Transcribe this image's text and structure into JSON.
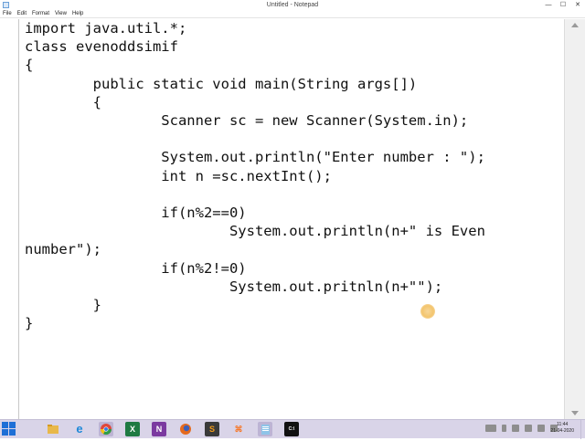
{
  "window": {
    "title": "Untitled - Notepad",
    "controls": [
      "—",
      "☐",
      "✕"
    ]
  },
  "menu": [
    "File",
    "Edit",
    "Format",
    "View",
    "Help"
  ],
  "editor": {
    "text": "import java.util.*;\nclass evenoddsimif\n{\n        public static void main(String args[])\n        {\n                Scanner sc = new Scanner(System.in);\n\n                System.out.println(\"Enter number : \");\n                int n =sc.nextInt();\n\n                if(n%2==0)\n                        System.out.println(n+\" is Even\nnumber\");\n                if(n%2!=0)\n                        System.out.pritnln(n+\"\");\n        }\n}"
  },
  "taskbar": {
    "apps": [
      {
        "name": "file-explorer",
        "label": "",
        "color": "#e8b84a"
      },
      {
        "name": "internet-explorer",
        "label": "e",
        "color": "#1e88d8"
      },
      {
        "name": "chrome",
        "label": "",
        "color": "#e0463a"
      },
      {
        "name": "excel",
        "label": "X",
        "color": "#1f7a43"
      },
      {
        "name": "onenote",
        "label": "N",
        "color": "#7b3aa0"
      },
      {
        "name": "firefox",
        "label": "",
        "color": "#e56a1e"
      },
      {
        "name": "sublime-text",
        "label": "S",
        "color": "#f09a1a"
      },
      {
        "name": "xampp",
        "label": "⌘",
        "color": "#f5782a"
      },
      {
        "name": "notepad",
        "label": "",
        "color": "#8ec4e8"
      },
      {
        "name": "command-prompt",
        "label": "C:\\",
        "color": "#111111"
      }
    ],
    "clock_time": "11:44",
    "clock_date": "21-04-2020"
  }
}
